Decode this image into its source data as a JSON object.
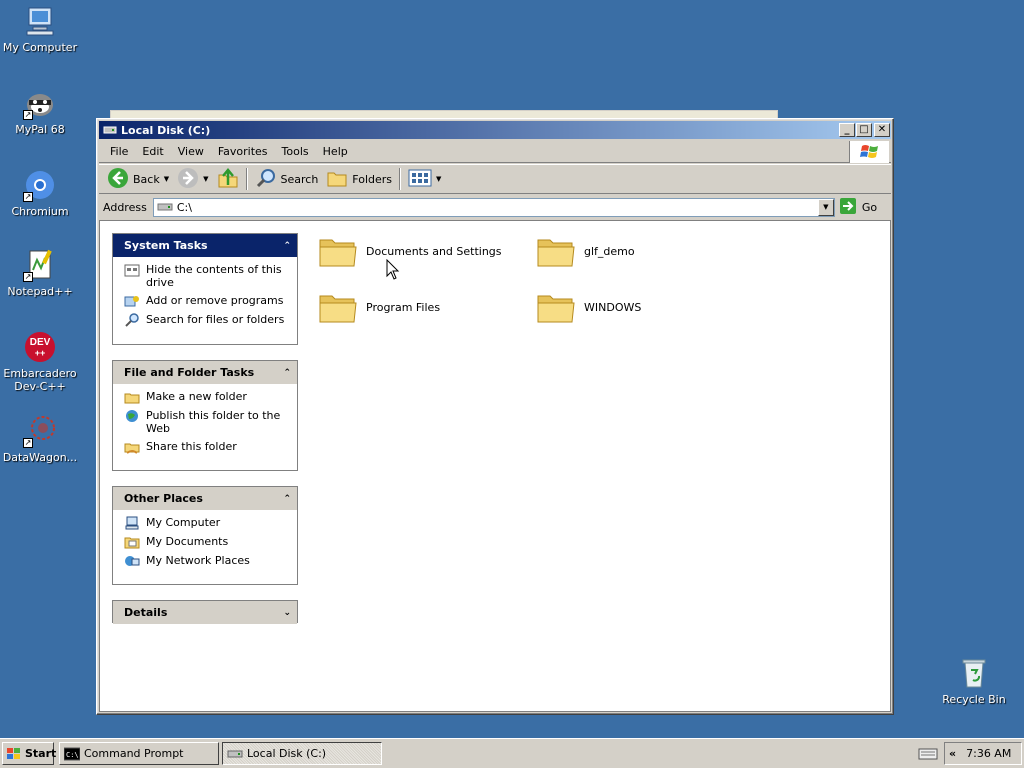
{
  "desktop": {
    "icons": [
      {
        "label": "My Computer",
        "icon": "my-computer-icon"
      },
      {
        "label": "MyPal 68",
        "icon": "mypal-icon"
      },
      {
        "label": "Chromium",
        "icon": "chromium-icon"
      },
      {
        "label": "Notepad++",
        "icon": "notepadpp-icon"
      },
      {
        "label": "Embarcadero Dev-C++",
        "icon": "devcpp-icon"
      },
      {
        "label": "DataWagon...",
        "icon": "datawagon-icon"
      },
      {
        "label": "Recycle Bin",
        "icon": "recycle-bin-icon"
      }
    ]
  },
  "window": {
    "title": "Local Disk (C:)",
    "menu": [
      "File",
      "Edit",
      "View",
      "Favorites",
      "Tools",
      "Help"
    ],
    "toolbar": {
      "back": "Back",
      "search": "Search",
      "folders": "Folders"
    },
    "address": {
      "label": "Address",
      "value": "C:\\",
      "go": "Go"
    },
    "panels": {
      "system_tasks": {
        "title": "System Tasks",
        "items": [
          "Hide the contents of this drive",
          "Add or remove programs",
          "Search for files or folders"
        ]
      },
      "file_folder_tasks": {
        "title": "File and Folder Tasks",
        "items": [
          "Make a new folder",
          "Publish this folder to the Web",
          "Share this folder"
        ]
      },
      "other_places": {
        "title": "Other Places",
        "items": [
          "My Computer",
          "My Documents",
          "My Network Places"
        ]
      },
      "details": {
        "title": "Details"
      }
    },
    "folders": [
      "Documents and Settings",
      "glf_demo",
      "Program Files",
      "WINDOWS"
    ]
  },
  "taskbar": {
    "start": "Start",
    "tasks": [
      "Command Prompt",
      "Local Disk (C:)"
    ],
    "clock": "7:36 AM",
    "tray_chevron": "«"
  },
  "colors": {
    "desktop": "#3a6ea5",
    "titlebar_start": "#0a246a",
    "titlebar_end": "#a6caf0",
    "face": "#d4d0c8",
    "folder": "#f5d77a"
  }
}
